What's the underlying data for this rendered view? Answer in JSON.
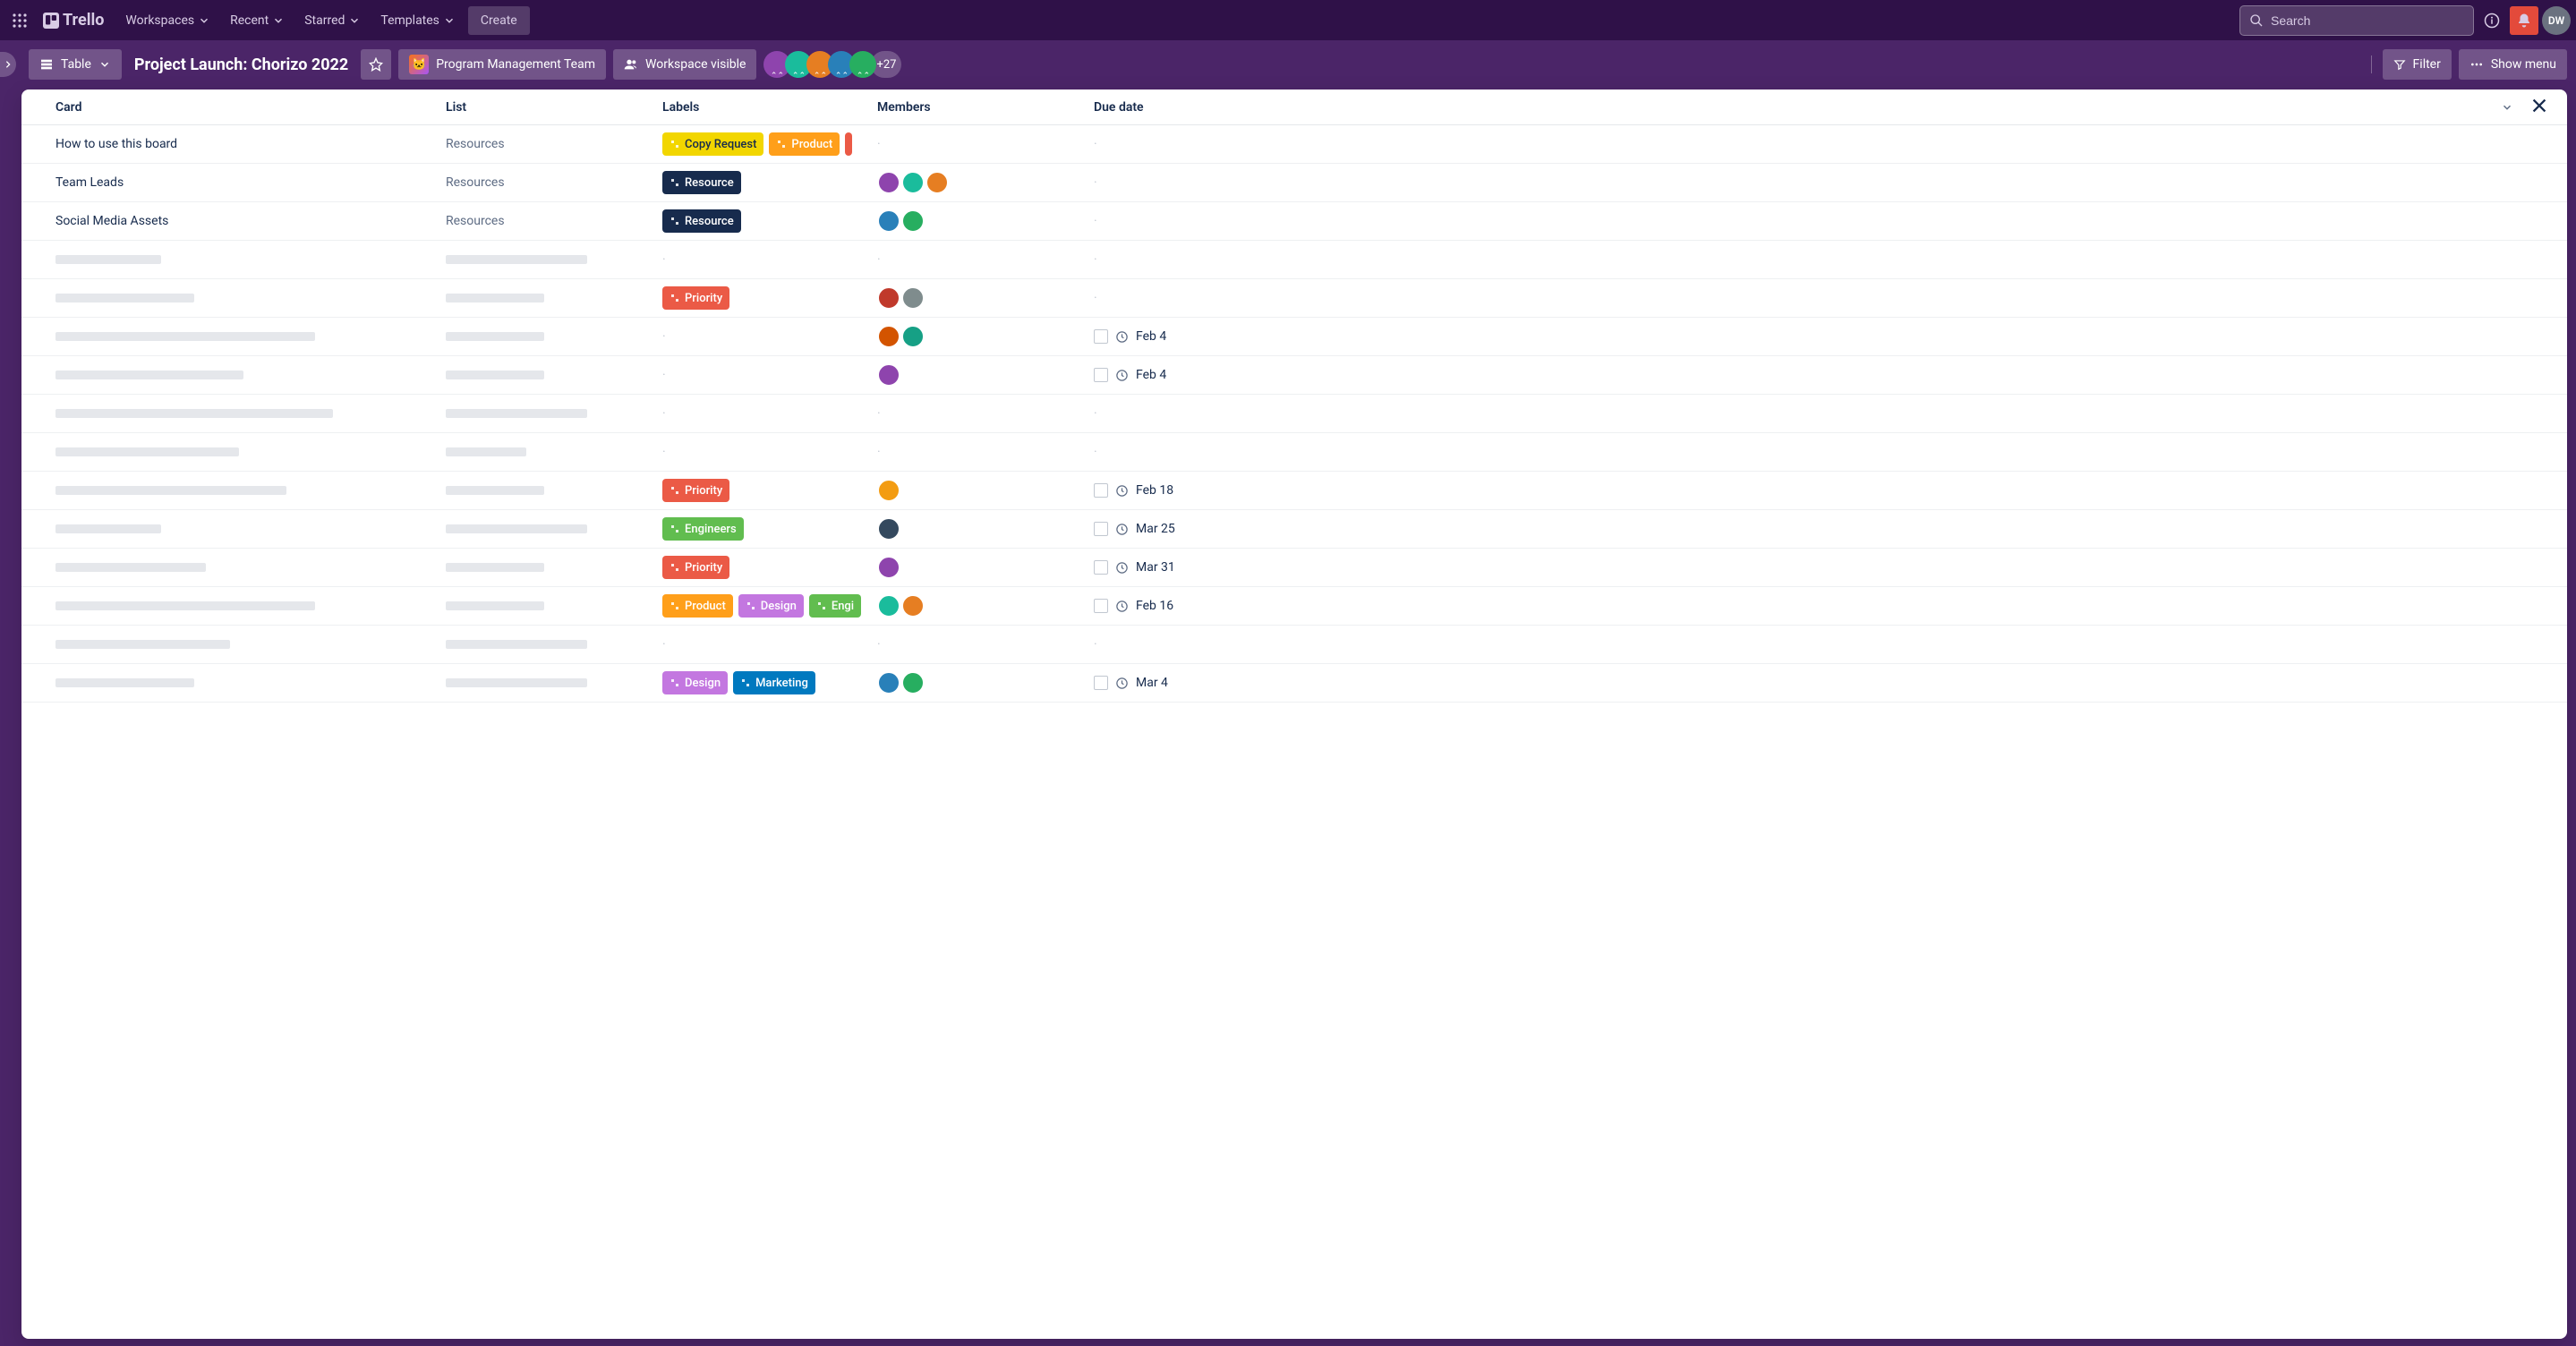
{
  "topnav": {
    "logo": "Trello",
    "menus": [
      "Workspaces",
      "Recent",
      "Starred",
      "Templates"
    ],
    "create": "Create",
    "search_placeholder": "Search",
    "user_initials": "DW"
  },
  "boardbar": {
    "view_label": "Table",
    "board_title": "Project Launch: Chorizo 2022",
    "team_name": "Program Management Team",
    "visibility": "Workspace visible",
    "plus_count": "+27",
    "filter": "Filter",
    "show_menu": "Show menu"
  },
  "table": {
    "headers": {
      "card": "Card",
      "list": "List",
      "labels": "Labels",
      "members": "Members",
      "due": "Due date"
    }
  },
  "labels_palette": {
    "copy_request": {
      "text": "Copy Request",
      "cls": "lc-yellow"
    },
    "product": {
      "text": "Product",
      "cls": "lc-orange"
    },
    "resource": {
      "text": "Resource",
      "cls": "lc-navy"
    },
    "priority": {
      "text": "Priority",
      "cls": "lc-red"
    },
    "engineers": {
      "text": "Engineers",
      "cls": "lc-green"
    },
    "design": {
      "text": "Design",
      "cls": "lc-purple-lt"
    },
    "marketing": {
      "text": "Marketing",
      "cls": "lc-blue"
    },
    "engi_trunc": {
      "text": "Engi",
      "cls": "lc-green"
    },
    "truncated": {
      "text": "",
      "cls": "lc-red-orange"
    }
  },
  "rows": [
    {
      "card": "How to use this board",
      "list": "Resources",
      "labels": [
        "copy_request",
        "product",
        "truncated"
      ],
      "members": 0,
      "due": ""
    },
    {
      "card": "Team Leads",
      "list": "Resources",
      "labels": [
        "resource"
      ],
      "members": 3,
      "due": ""
    },
    {
      "card": "Social Media Assets",
      "list": "Resources",
      "labels": [
        "resource"
      ],
      "members": 2,
      "due": ""
    },
    {
      "skel_card": 118,
      "skel_list": 158,
      "labels": [],
      "members": 0,
      "due": ""
    },
    {
      "skel_card": 155,
      "skel_list": 110,
      "labels": [
        "priority"
      ],
      "members": 2,
      "due": ""
    },
    {
      "skel_card": 290,
      "skel_list": 110,
      "labels": [],
      "members": 2,
      "due": "Feb 4"
    },
    {
      "skel_card": 210,
      "skel_list": 110,
      "labels": [],
      "members": 1,
      "due": "Feb 4"
    },
    {
      "skel_card": 310,
      "skel_list": 158,
      "labels": [],
      "members": 0,
      "due": ""
    },
    {
      "skel_card": 205,
      "skel_list": 90,
      "labels": [],
      "members": 0,
      "due": ""
    },
    {
      "skel_card": 258,
      "skel_list": 110,
      "labels": [
        "priority"
      ],
      "members": 1,
      "due": "Feb 18"
    },
    {
      "skel_card": 118,
      "skel_list": 158,
      "labels": [
        "engineers"
      ],
      "members": 1,
      "due": "Mar 25"
    },
    {
      "skel_card": 168,
      "skel_list": 110,
      "labels": [
        "priority"
      ],
      "members": 1,
      "due": "Mar 31"
    },
    {
      "skel_card": 290,
      "skel_list": 110,
      "labels": [
        "product",
        "design",
        "engi_trunc"
      ],
      "members": 2,
      "due": "Feb 16"
    },
    {
      "skel_card": 195,
      "skel_list": 158,
      "labels": [],
      "members": 0,
      "due": ""
    },
    {
      "skel_card": 155,
      "skel_list": 158,
      "labels": [
        "design",
        "marketing"
      ],
      "members": 2,
      "due": "Mar 4"
    }
  ]
}
